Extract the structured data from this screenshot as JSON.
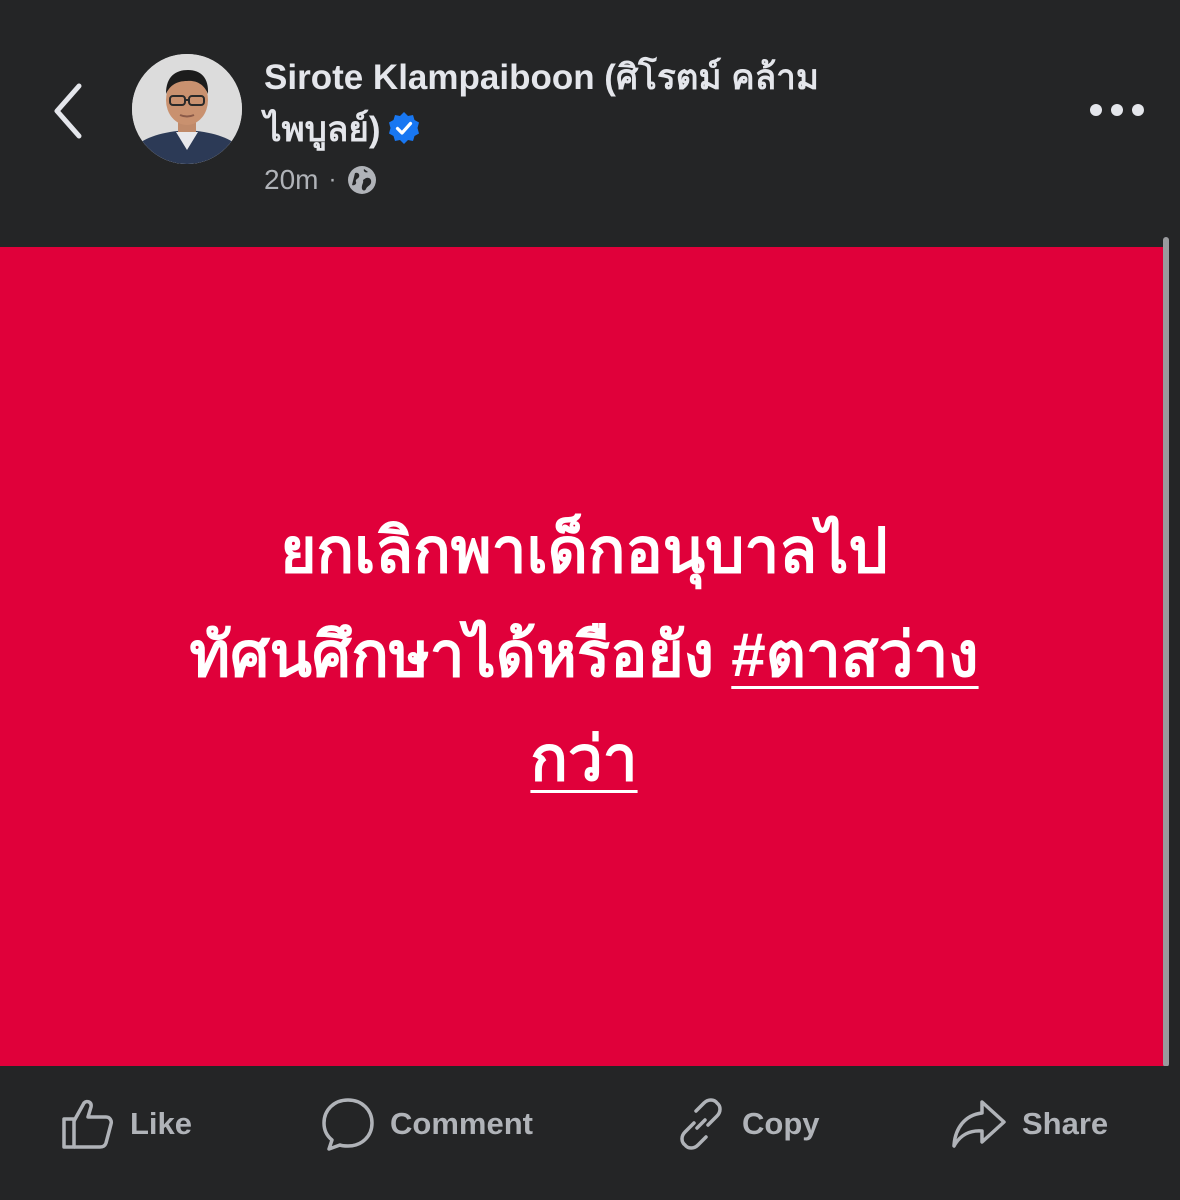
{
  "header": {
    "author_name": "Sirote Klampaiboon (ศิโรตม์ คล้าม ไพบูลย์)",
    "timestamp": "20m",
    "separator": "·",
    "privacy_icon": "globe-icon",
    "back_icon": "chevron-left-icon",
    "more_icon": "more-horizontal-icon",
    "verified_icon": "verified-badge-icon"
  },
  "post": {
    "background_color": "#e0003a",
    "text_line_1": "ยกเลิกพาเด็กอนุบาลไป",
    "text_line_2": "ทัศนศึกษาได้หรือยัง",
    "hashtag": "#ตาสว่างกว่า",
    "hashtag_part_1": "#ตาสว่าง",
    "hashtag_part_2": "กว่า"
  },
  "actions": {
    "like_label": "Like",
    "comment_label": "Comment",
    "copy_label": "Copy",
    "share_label": "Share"
  },
  "colors": {
    "background": "#242526",
    "text_primary": "#e4e6eb",
    "text_secondary": "#b0b3b8",
    "verified": "#1877f2"
  }
}
